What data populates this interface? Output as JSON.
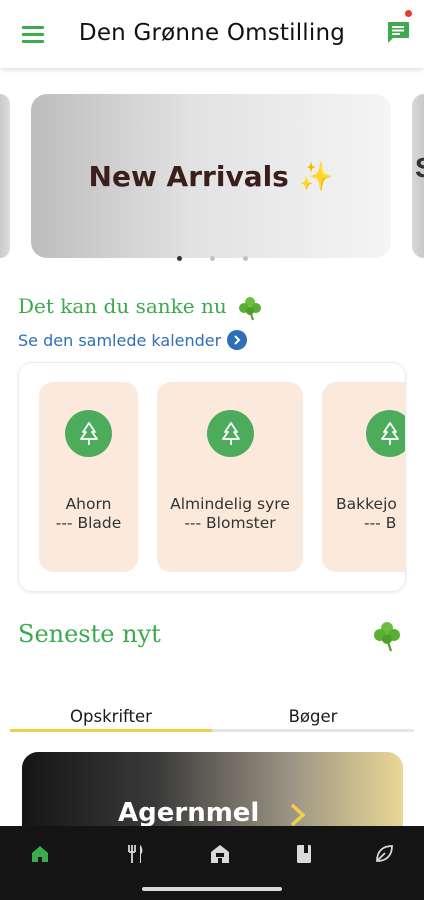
{
  "header": {
    "title": "Den Grønne Omstilling",
    "has_notification": true
  },
  "banner": {
    "title": "New Arrivals ✨",
    "slide_count": 3,
    "active_slide": 1
  },
  "foraging": {
    "title": "Det kan du sanke nu",
    "calendar_link": "Se den samlede kalender",
    "items": [
      {
        "name": "Ahorn",
        "sub": "---  Blade",
        "icon": "tree-icon"
      },
      {
        "name": "Almindelig syre",
        "sub": "---  Blomster",
        "icon": "tree-icon"
      },
      {
        "name": "Bakkejo",
        "sub": "---  B",
        "icon": "tree-icon"
      }
    ]
  },
  "news": {
    "title": "Seneste nyt",
    "tabs": [
      {
        "label": "Opskrifter",
        "active": true
      },
      {
        "label": "Bøger",
        "active": false
      }
    ],
    "featured": {
      "title": "Agernmel"
    }
  },
  "bottom_nav": [
    {
      "name": "home-icon",
      "active": true
    },
    {
      "name": "fork-knife-icon",
      "active": false
    },
    {
      "name": "store-icon",
      "active": false
    },
    {
      "name": "book-icon",
      "active": false
    },
    {
      "name": "leaf-icon",
      "active": false
    }
  ],
  "colors": {
    "accent_green": "#3bab4e",
    "link_blue": "#2f6fb6",
    "card_bg": "#fbeadb",
    "tab_indicator": "#f2cf4a",
    "nav_bg": "#141414"
  }
}
